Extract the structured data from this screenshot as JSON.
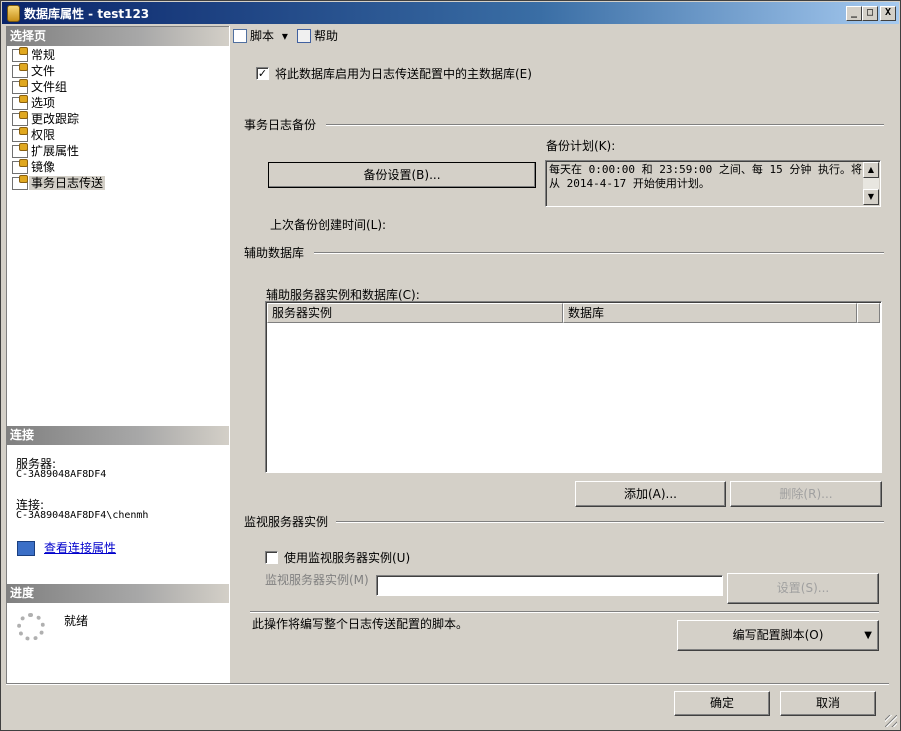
{
  "window": {
    "title": "数据库属性 - test123",
    "controls": {
      "minimize": "_",
      "maximize": "□",
      "close": "X"
    }
  },
  "left": {
    "pages_header": "选择页",
    "pages": [
      {
        "label": "常规",
        "icon": "page-icon"
      },
      {
        "label": "文件",
        "icon": "page-icon"
      },
      {
        "label": "文件组",
        "icon": "page-icon"
      },
      {
        "label": "选项",
        "icon": "page-icon"
      },
      {
        "label": "更改跟踪",
        "icon": "page-icon"
      },
      {
        "label": "权限",
        "icon": "page-icon"
      },
      {
        "label": "扩展属性",
        "icon": "page-icon"
      },
      {
        "label": "镜像",
        "icon": "page-icon"
      },
      {
        "label": "事务日志传送",
        "icon": "page-icon",
        "selected": true
      }
    ],
    "connection_header": "连接",
    "server_label": "服务器:",
    "server_value": "C-3A89048AF8DF4",
    "connection_label": "连接:",
    "connection_value": "C-3A89048AF8DF4\\chenmh",
    "view_connection_link": "查看连接属性",
    "progress_header": "进度",
    "progress_status": "就绪"
  },
  "toolbar": {
    "script_label": "脚本",
    "script_dropdown": "▾",
    "help_label": "帮助"
  },
  "main": {
    "enable_primary_checkbox": {
      "checked": true,
      "mark": "✓",
      "label": "将此数据库启用为日志传送配置中的主数据库(E)"
    },
    "log_backup_group": "事务日志备份",
    "backup_schedule_label": "备份计划(K):",
    "backup_settings_button": "备份设置(B)...",
    "backup_schedule_text": "每天在 0:00:00 和 23:59:00 之间、每 15 分钟 执行。将\n从 2014-4-17 开始使用计划。",
    "last_backup_label": "上次备份创建时间(L):",
    "secondary_group": "辅助数据库",
    "secondary_list_label": "辅助服务器实例和数据库(C):",
    "secondary_columns": [
      "服务器实例",
      "数据库"
    ],
    "secondary_rows": [],
    "add_button": "添加(A)...",
    "remove_button": "删除(R)...",
    "monitor_group": "监视服务器实例",
    "use_monitor_checkbox": {
      "checked": false,
      "label": "使用监视服务器实例(U)"
    },
    "monitor_instance_label": "监视服务器实例(M)",
    "monitor_instance_value": "",
    "monitor_settings_button": "设置(S)...",
    "script_info_text": "此操作将编写整个日志传送配置的脚本。",
    "script_config_button": "编写配置脚本(O)",
    "script_config_dropdown": "▼"
  },
  "footer": {
    "ok_button": "确定",
    "cancel_button": "取消"
  },
  "colors": {
    "title_bar": "#0a246a",
    "window_face": "#d4d0c8",
    "link": "#0000cc"
  }
}
